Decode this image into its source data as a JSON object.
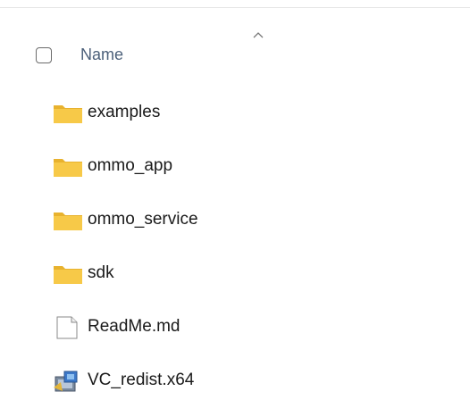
{
  "header": {
    "name_label": "Name",
    "sort_icon": "chevron-up-icon"
  },
  "items": [
    {
      "name": "examples",
      "type": "folder",
      "icon": "folder-icon"
    },
    {
      "name": "ommo_app",
      "type": "folder",
      "icon": "folder-icon"
    },
    {
      "name": "ommo_service",
      "type": "folder",
      "icon": "folder-icon"
    },
    {
      "name": "sdk",
      "type": "folder",
      "icon": "folder-icon"
    },
    {
      "name": "ReadMe.md",
      "type": "file",
      "icon": "document-icon"
    },
    {
      "name": "VC_redist.x64",
      "type": "installer",
      "icon": "installer-icon"
    }
  ],
  "colors": {
    "folder": "#f7c948",
    "folder_tab": "#e8b22e",
    "header_text": "#4c607a",
    "item_text": "#1a1a1a"
  }
}
